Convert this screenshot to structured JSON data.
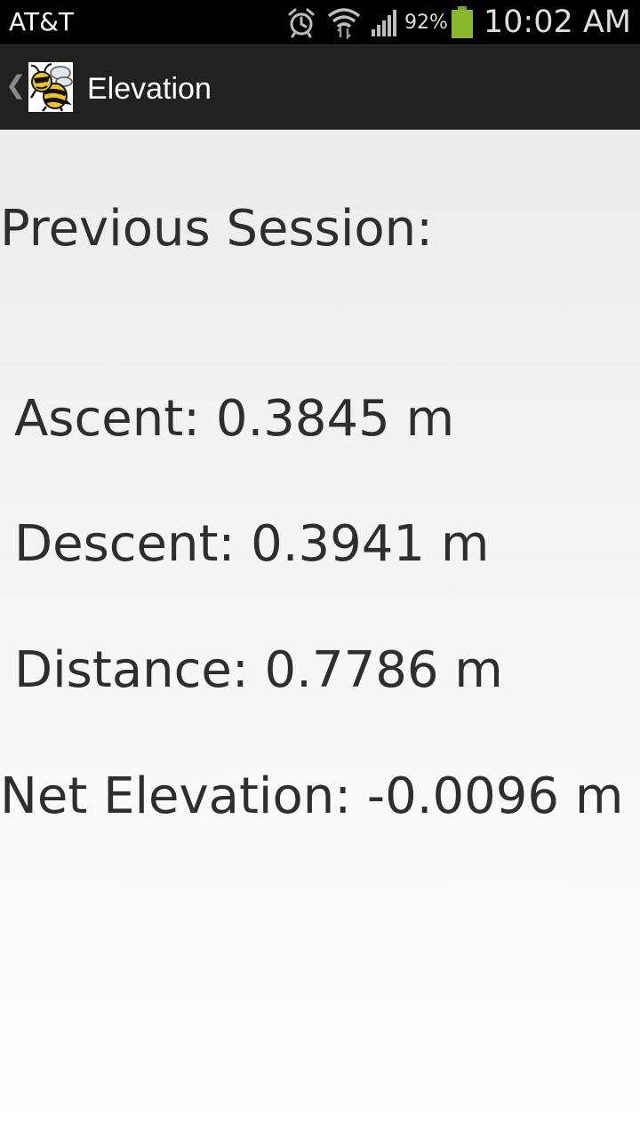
{
  "status_bar": {
    "carrier": "AT&T",
    "battery_percent": "92%",
    "time": "10:02 AM",
    "icons": [
      "alarm-icon",
      "wifi-icon",
      "signal-icon",
      "battery-icon"
    ]
  },
  "action_bar": {
    "title": "Elevation",
    "icons": [
      "back-chevron-icon",
      "yellow-jacket-logo-icon"
    ]
  },
  "session": {
    "heading": "Previous Session:",
    "ascent": "Ascent: 0.3845 m",
    "descent": "Descent: 0.3941 m",
    "distance": "Distance: 0.7786 m",
    "net_elevation": "Net Elevation: -0.0096 m"
  },
  "colors": {
    "status_bar_bg": "#000000",
    "action_bar_bg": "#212121",
    "text": "#2e2e2e",
    "battery": "#8ab82c"
  }
}
